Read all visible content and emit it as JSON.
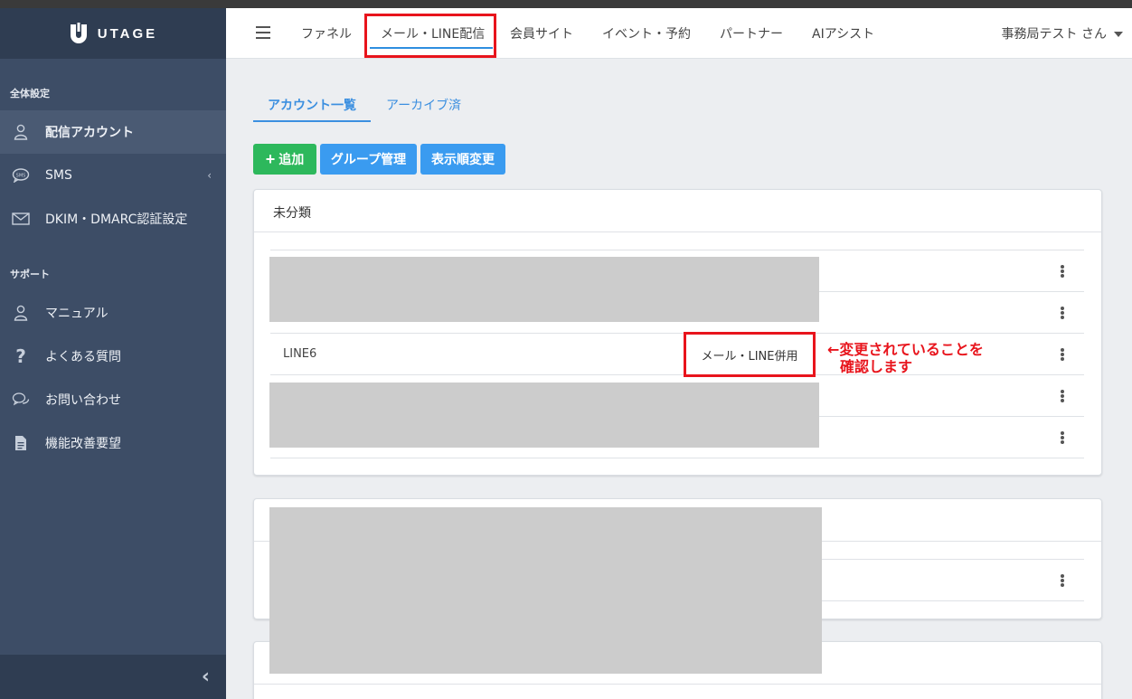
{
  "brand": {
    "name": "UTAGE"
  },
  "sidebar": {
    "sections": [
      {
        "label": "全体設定"
      },
      {
        "label": "サポート"
      }
    ],
    "items": [
      {
        "label": "配信アカウント",
        "icon": "user-icon"
      },
      {
        "label": "SMS",
        "icon": "sms-bubble-icon"
      },
      {
        "label": "DKIM・DMARC認証設定",
        "icon": "envelope-icon"
      },
      {
        "label": "マニュアル",
        "icon": "user-icon"
      },
      {
        "label": "よくある質問",
        "icon": "question-icon"
      },
      {
        "label": "お問い合わせ",
        "icon": "chat-icon"
      },
      {
        "label": "機能改善要望",
        "icon": "document-icon"
      }
    ],
    "sms_chevron": "‹",
    "collapse_chevron": "‹"
  },
  "header": {
    "nav": [
      "ファネル",
      "メール・LINE配信",
      "会員サイト",
      "イベント・予約",
      "パートナー",
      "AIアシスト"
    ],
    "user": "事務局テスト さん"
  },
  "tabs": [
    "アカウント一覧",
    "アーカイブ済"
  ],
  "buttons": {
    "add": "追加",
    "add_icon": "+",
    "group": "グループ管理",
    "order": "表示順変更"
  },
  "card1": {
    "title": "未分類",
    "row_name": "LINE6",
    "row_type": "メール・LINE併用"
  },
  "annotation": {
    "line1": "←変更されていることを",
    "line2": "確認します"
  },
  "colors": {
    "accent": "#3b8fe0",
    "highlight": "#e8141c",
    "sidebar": "#3d4d66",
    "green": "#2db85c"
  }
}
